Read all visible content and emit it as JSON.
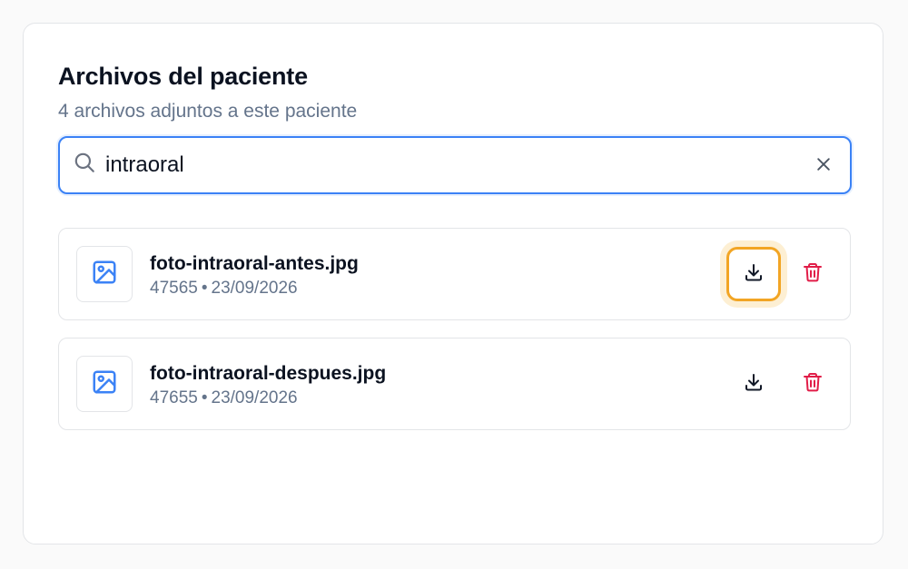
{
  "panel": {
    "title": "Archivos del paciente",
    "subtitle": "4 archivos adjuntos a este paciente"
  },
  "search": {
    "value": "intraoral",
    "icon": "search-icon",
    "clear_icon": "close-icon"
  },
  "files": [
    {
      "name": "foto-intraoral-antes.jpg",
      "size": "47565",
      "separator": "•",
      "date": "23/09/2026",
      "icon": "image-icon",
      "download_focused": true
    },
    {
      "name": "foto-intraoral-despues.jpg",
      "size": "47655",
      "separator": "•",
      "date": "23/09/2026",
      "icon": "image-icon",
      "download_focused": false
    }
  ],
  "colors": {
    "accent": "#3b82f6",
    "focus_ring": "#f2a524",
    "delete": "#e11d48",
    "image_icon": "#3b82f6"
  }
}
